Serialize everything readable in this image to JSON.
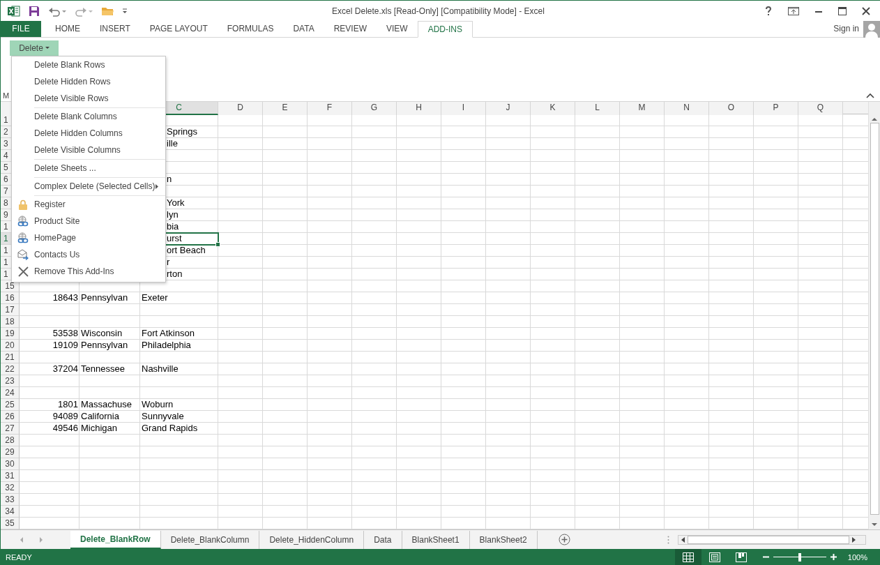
{
  "window": {
    "title": "Excel Delete.xls  [Read-Only]  [Compatibility Mode] - Excel"
  },
  "ribbon_tabs": [
    {
      "label": "FILE",
      "kind": "file",
      "selected": false
    },
    {
      "label": "HOME",
      "kind": "tab",
      "selected": false
    },
    {
      "label": "INSERT",
      "kind": "tab",
      "selected": false
    },
    {
      "label": "PAGE LAYOUT",
      "kind": "tab",
      "selected": false
    },
    {
      "label": "FORMULAS",
      "kind": "tab",
      "selected": false
    },
    {
      "label": "DATA",
      "kind": "tab",
      "selected": false
    },
    {
      "label": "REVIEW",
      "kind": "tab",
      "selected": false
    },
    {
      "label": "VIEW",
      "kind": "tab",
      "selected": false
    },
    {
      "label": "ADD-INS",
      "kind": "tab",
      "selected": true
    }
  ],
  "account": {
    "label": "Sign in"
  },
  "delete_button": {
    "label": "Delete",
    "expanded": true
  },
  "delete_menu": {
    "groups": [
      [
        {
          "label": "Delete Blank Rows",
          "kind": "plain"
        },
        {
          "label": "Delete Hidden Rows",
          "kind": "plain"
        },
        {
          "label": "Delete Visible Rows",
          "kind": "plain"
        }
      ],
      [
        {
          "label": "Delete Blank Columns",
          "kind": "plain"
        },
        {
          "label": "Delete Hidden Columns",
          "kind": "plain"
        },
        {
          "label": "Delete Visible Columns",
          "kind": "plain"
        }
      ],
      [
        {
          "label": "Delete Sheets ...",
          "kind": "plain"
        }
      ],
      [
        {
          "label": "Complex Delete (Selected Cells)",
          "kind": "submenu"
        }
      ],
      [
        {
          "label": "Register",
          "kind": "lock"
        },
        {
          "label": "Product Site",
          "kind": "globe"
        },
        {
          "label": "HomePage",
          "kind": "globe"
        },
        {
          "label": "Contacts Us",
          "kind": "mail"
        },
        {
          "label": "Remove This Add-Ins",
          "kind": "cross"
        }
      ]
    ]
  },
  "name_box": {
    "value": "M"
  },
  "columns": [
    {
      "label": "C",
      "selected": true
    },
    {
      "label": "D",
      "selected": false
    },
    {
      "label": "E",
      "selected": false
    },
    {
      "label": "F",
      "selected": false
    },
    {
      "label": "G",
      "selected": false
    },
    {
      "label": "H",
      "selected": false
    },
    {
      "label": "I",
      "selected": false
    },
    {
      "label": "J",
      "selected": false
    },
    {
      "label": "K",
      "selected": false
    },
    {
      "label": "L",
      "selected": false
    },
    {
      "label": "M",
      "selected": false
    },
    {
      "label": "N",
      "selected": false
    },
    {
      "label": "O",
      "selected": false
    },
    {
      "label": "P",
      "selected": false
    },
    {
      "label": "Q",
      "selected": false
    }
  ],
  "rows": [
    {
      "header": "1",
      "selected": false,
      "under_menu": true
    },
    {
      "header": "2",
      "selected": false,
      "under_menu": true,
      "c": "Springs"
    },
    {
      "header": "3",
      "selected": false,
      "under_menu": true,
      "c": "ille"
    },
    {
      "header": "4",
      "selected": false,
      "under_menu": true
    },
    {
      "header": "5",
      "selected": false,
      "under_menu": true
    },
    {
      "header": "6",
      "selected": false,
      "under_menu": true,
      "c": "n"
    },
    {
      "header": "7",
      "selected": false,
      "under_menu": true
    },
    {
      "header": "8",
      "selected": false,
      "under_menu": true,
      "c": "York"
    },
    {
      "header": "9",
      "selected": false,
      "under_menu": true,
      "c": "lyn"
    },
    {
      "header": "1",
      "selected": false,
      "under_menu": true,
      "c": "bia"
    },
    {
      "header": "1",
      "selected": true,
      "under_menu": true,
      "c": "urst"
    },
    {
      "header": "1",
      "selected": false,
      "under_menu": true,
      "c": "ort Beach"
    },
    {
      "header": "1",
      "selected": false,
      "under_menu": true,
      "c": "r"
    },
    {
      "header": "1",
      "selected": false,
      "under_menu": true,
      "c": "rton"
    },
    {
      "header": "15",
      "selected": false,
      "under_menu": false
    },
    {
      "header": "16",
      "selected": false,
      "under_menu": false,
      "a": "18643",
      "b": "Pennsylvan",
      "c": "Exeter"
    },
    {
      "header": "17",
      "selected": false,
      "under_menu": false
    },
    {
      "header": "18",
      "selected": false,
      "under_menu": false
    },
    {
      "header": "19",
      "selected": false,
      "under_menu": false,
      "a": "53538",
      "b": "Wisconsin",
      "c": "Fort Atkinson"
    },
    {
      "header": "20",
      "selected": false,
      "under_menu": false,
      "a": "19109",
      "b": "Pennsylvan",
      "c": "Philadelphia"
    },
    {
      "header": "21",
      "selected": false,
      "under_menu": false
    },
    {
      "header": "22",
      "selected": false,
      "under_menu": false,
      "a": "37204",
      "b": "Tennessee",
      "c": "Nashville"
    },
    {
      "header": "23",
      "selected": false,
      "under_menu": false
    },
    {
      "header": "24",
      "selected": false,
      "under_menu": false
    },
    {
      "header": "25",
      "selected": false,
      "under_menu": false,
      "a": "1801",
      "b": "Massachuse",
      "c": "Woburn"
    },
    {
      "header": "26",
      "selected": false,
      "under_menu": false,
      "a": "94089",
      "b": "California",
      "c": "Sunnyvale"
    },
    {
      "header": "27",
      "selected": false,
      "under_menu": false,
      "a": "49546",
      "b": "Michigan",
      "c": "Grand Rapids"
    },
    {
      "header": "28",
      "selected": false,
      "under_menu": false
    },
    {
      "header": "29",
      "selected": false,
      "under_menu": false
    },
    {
      "header": "30",
      "selected": false,
      "under_menu": false
    },
    {
      "header": "31",
      "selected": false,
      "under_menu": false
    },
    {
      "header": "32",
      "selected": false,
      "under_menu": false
    },
    {
      "header": "33",
      "selected": false,
      "under_menu": false
    },
    {
      "header": "34",
      "selected": false,
      "under_menu": false
    },
    {
      "header": "35",
      "selected": false,
      "under_menu": false
    }
  ],
  "sheet_tabs": [
    {
      "label": "Delete_BlankRow",
      "selected": true
    },
    {
      "label": "Delete_BlankColumn",
      "selected": false
    },
    {
      "label": "Delete_HiddenColumn",
      "selected": false
    },
    {
      "label": "Data",
      "selected": false
    },
    {
      "label": "BlankSheet1",
      "selected": false
    },
    {
      "label": "BlankSheet2",
      "selected": false
    }
  ],
  "status_bar": {
    "status": "READY",
    "views": [
      {
        "selected": true
      },
      {
        "selected": false
      },
      {
        "selected": false
      }
    ],
    "zoom": {
      "level": 0.5,
      "reading": "100%"
    }
  }
}
